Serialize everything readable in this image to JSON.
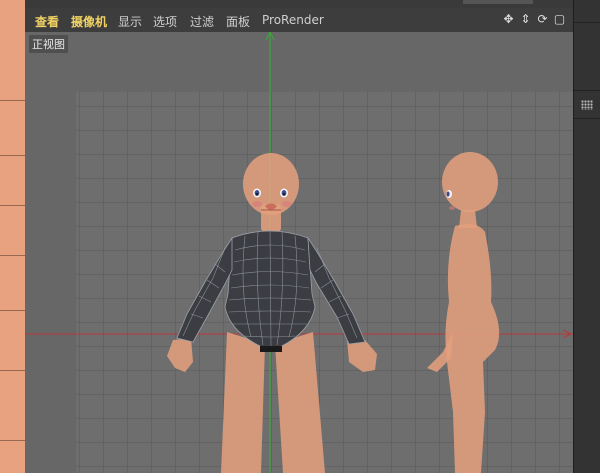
{
  "menubar": {
    "items": [
      "查看",
      "摄像机",
      "显示",
      "选项",
      "过滤",
      "面板",
      "ProRender"
    ],
    "active_items": [
      0,
      1
    ]
  },
  "toolbar_icons": [
    "move-view-icon",
    "dolly-view-icon",
    "rotate-view-icon",
    "maximize-view-icon"
  ],
  "viewport": {
    "label": "正视图",
    "background_color": "#676767",
    "backdrop_color": "#6d6d6d",
    "axis_colors": {
      "x": "#b63a3a",
      "y": "#3aa63a"
    }
  },
  "colors": {
    "active_menu": "#f0d264",
    "menu_text": "#cfcfcf",
    "skin": "#e7a07c",
    "garment": "#3b3d42"
  }
}
